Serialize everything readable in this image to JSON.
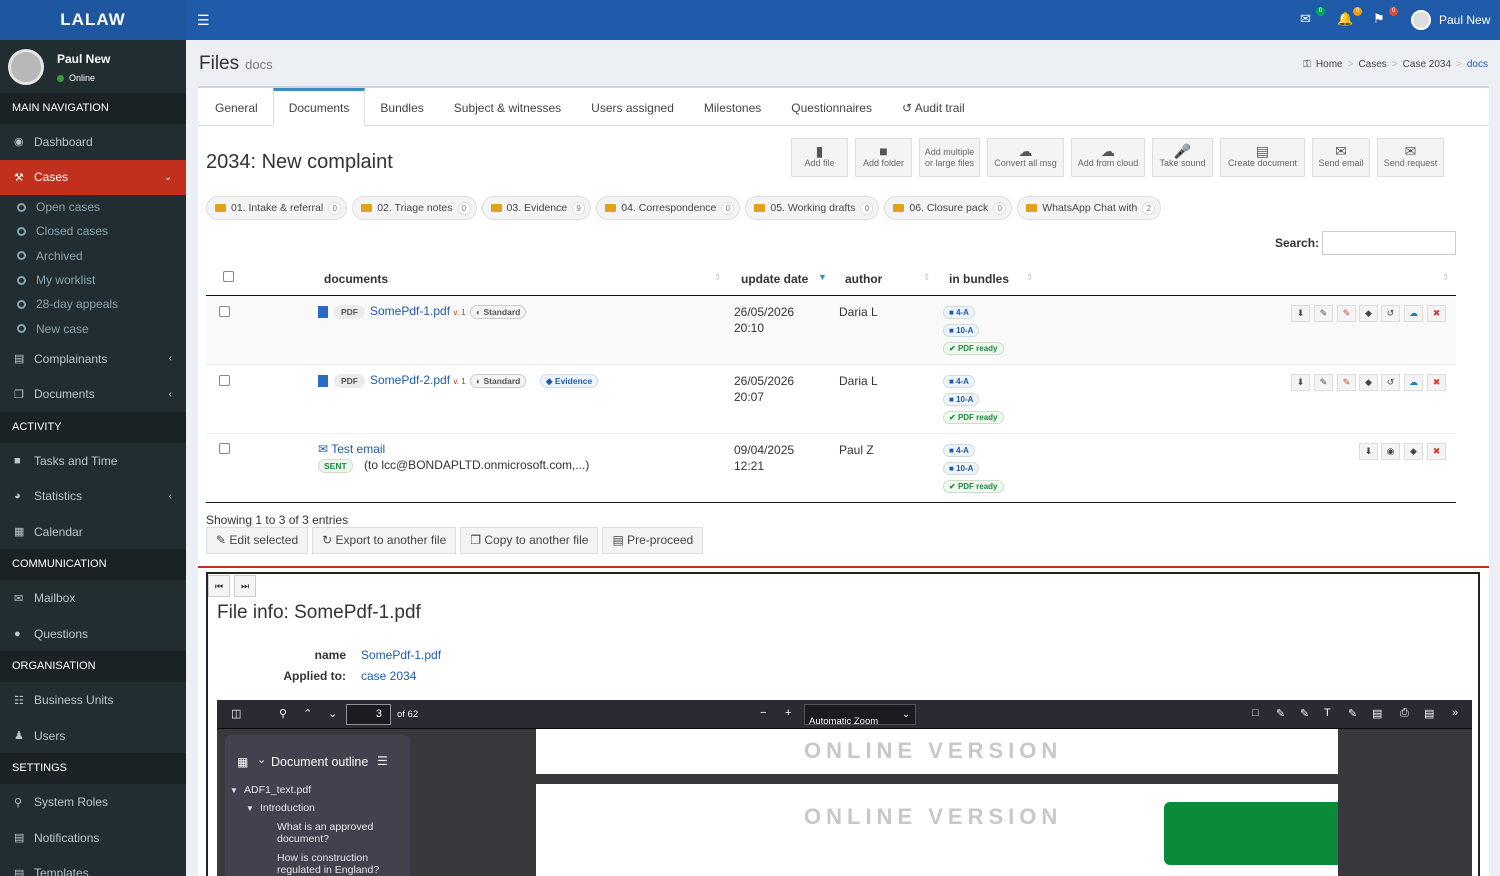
{
  "app": {
    "logo": "LALAW",
    "user_name": "Paul New",
    "user_status": "Online"
  },
  "topbar": {
    "mail_badge": "0",
    "bell_badge": "0",
    "flag_badge": "0"
  },
  "sidebar": {
    "sections": {
      "main": "MAIN NAVIGATION",
      "activity": "ACTIVITY",
      "communication": "COMMUNICATION",
      "organisation": "ORGANISATION",
      "settings": "SETTINGS"
    },
    "dashboard": "Dashboard",
    "cases": "Cases",
    "case_sub": [
      "Open cases",
      "Closed cases",
      "Archived",
      "My worklist",
      "28-day appeals",
      "New case"
    ],
    "complainants": "Complainants",
    "documents": "Documents",
    "tasks": "Tasks and Time",
    "statistics": "Statistics",
    "calendar": "Calendar",
    "mailbox": "Mailbox",
    "questions": "Questions",
    "business_units": "Business Units",
    "users": "Users",
    "system_roles": "System Roles",
    "notifications": "Notifications",
    "templates": "Templates"
  },
  "header": {
    "title": "Files",
    "subtitle": "docs"
  },
  "breadcrumb": [
    "Home",
    "Cases",
    "Case 2034",
    "docs"
  ],
  "tabs": [
    "General",
    "Documents",
    "Bundles",
    "Subject & witnesses",
    "Users assigned",
    "Milestones",
    "Questionnaires",
    "Audit trail"
  ],
  "file_title": "2034: New complaint",
  "actions": [
    {
      "l1": "Add file",
      "l2": ""
    },
    {
      "l1": "Add folder",
      "l2": ""
    },
    {
      "l1": "Add multiple",
      "l2": "or large files"
    },
    {
      "l1": "Convert all msg",
      "l2": ""
    },
    {
      "l1": "Add from cloud",
      "l2": ""
    },
    {
      "l1": "Take sound",
      "l2": ""
    },
    {
      "l1": "Create document",
      "l2": ""
    },
    {
      "l1": "Send email",
      "l2": ""
    },
    {
      "l1": "Send request",
      "l2": ""
    }
  ],
  "folders": [
    {
      "name": "01. Intake & referral",
      "count": "0"
    },
    {
      "name": "02. Triage notes",
      "count": "0"
    },
    {
      "name": "03. Evidence",
      "count": "9"
    },
    {
      "name": "04. Correspondence",
      "count": "0"
    },
    {
      "name": "05. Working drafts",
      "count": "0"
    },
    {
      "name": "06. Closure pack",
      "count": "0"
    },
    {
      "name": "WhatsApp Chat with",
      "count": "2"
    }
  ],
  "search": {
    "label": "Search:",
    "value": ""
  },
  "table": {
    "headers": [
      "documents",
      "update date",
      "author",
      "in bundles"
    ],
    "rows": [
      {
        "type": "PDF",
        "name": "SomePdf-1.pdf",
        "version": "v. 1",
        "tags": [
          "Standard"
        ],
        "date": "26/05/2026",
        "time": "20:10",
        "author": "Daria L",
        "bundles": [
          "4-A",
          "10-A"
        ],
        "status": "PDF ready"
      },
      {
        "type": "PDF",
        "name": "SomePdf-2.pdf",
        "version": "v. 1",
        "tags": [
          "Standard",
          "Evidence"
        ],
        "date": "26/05/2026",
        "time": "20:07",
        "author": "Daria L",
        "bundles": [
          "4-A",
          "10-A"
        ],
        "status": "PDF ready"
      },
      {
        "type": "email",
        "name": "Test email",
        "sent": "SENT",
        "to": "(to lcc@BONDAPLTD.onmicrosoft.com,...)",
        "date": "09/04/2025",
        "time": "12:21",
        "author": "Paul Z",
        "bundles": [
          "4-A",
          "10-A"
        ],
        "status": "PDF ready"
      }
    ],
    "showing": "Showing 1 to 3 of 3 entries"
  },
  "bulk": [
    "Edit selected",
    "Export to another file",
    "Copy to another file",
    "Pre-proceed"
  ],
  "info": {
    "title": "File info: SomePdf-1.pdf",
    "name_label": "name",
    "name_value": "SomePdf-1.pdf",
    "applied_label": "Applied to:",
    "applied_value": "case 2034"
  },
  "pdf": {
    "page": "3",
    "of": "of 62",
    "zoom": "Automatic Zoom",
    "outline_title": "Document outline",
    "outline": [
      "ADF1_text.pdf",
      "Introduction",
      "What is an approved",
      "document?",
      "How is construction",
      "regulated in England?"
    ],
    "watermark": "ONLINE VERSION"
  }
}
